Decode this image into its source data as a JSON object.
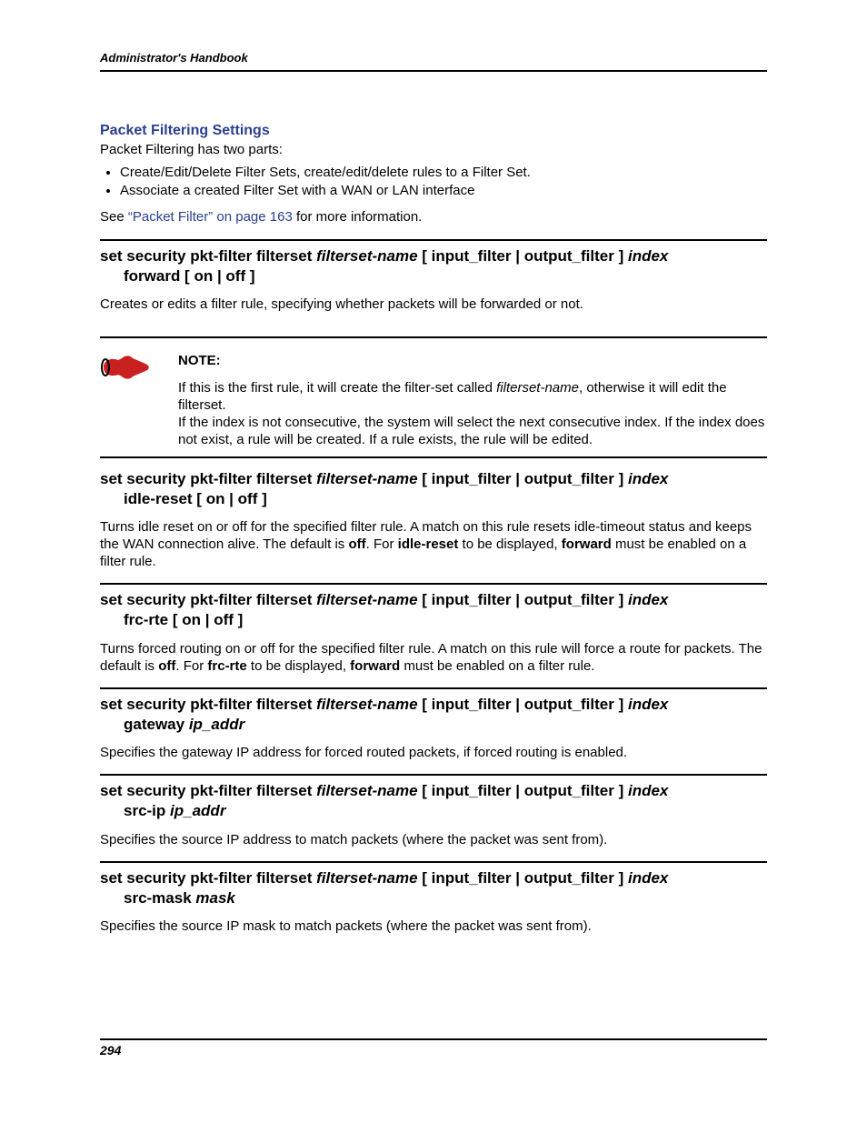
{
  "header": {
    "running": "Administrator's Handbook"
  },
  "section": {
    "title": "Packet Filtering Settings",
    "intro": "Packet Filtering has two parts:",
    "bullets": [
      "Create/Edit/Delete Filter Sets, create/edit/delete rules to a Filter Set.",
      "Associate a created Filter Set with a WAN or LAN interface"
    ],
    "see_prefix": "See ",
    "see_link": "“Packet Filter” on page 163",
    "see_suffix": " for more information."
  },
  "commands": [
    {
      "title_pre": "set security pkt-filter filterset ",
      "title_var1": "filterset-name",
      "title_mid": " [ input_filter | output_filter ] ",
      "title_var2": "index",
      "title_cont": "forward [ on | off ]",
      "desc_html": "Creates or edits a filter rule, specifying whether packets will be forwarded or not."
    },
    {
      "title_pre": "set security pkt-filter filterset ",
      "title_var1": "filterset-name",
      "title_mid": " [ input_filter | output_filter ] ",
      "title_var2": "index",
      "title_cont": "idle-reset [ on | off ]",
      "desc_html": "Turns idle reset on or off for the specified filter rule. A match on this rule resets idle-timeout status and keeps the WAN connection alive. The default is <b>off</b>. For <b>idle-reset</b> to be displayed, <b>forward</b> must be enabled on a filter rule."
    },
    {
      "title_pre": "set security pkt-filter filterset ",
      "title_var1": "filterset-name",
      "title_mid": " [ input_filter | output_filter ] ",
      "title_var2": "index",
      "title_cont": "frc-rte [ on | off ]",
      "desc_html": "Turns forced routing on or off for the specified filter rule. A match on this rule will force a route for packets. The default is <b>off</b>. For <b>frc-rte</b> to be displayed, <b>forward</b> must be enabled on a filter rule."
    },
    {
      "title_pre": "set security pkt-filter filterset ",
      "title_var1": "filterset-name",
      "title_mid": " [ input_filter | output_filter ] ",
      "title_var2": "index",
      "title_cont_pre": "gateway ",
      "title_cont_var": "ip_addr",
      "desc_html": "Specifies the gateway IP address for forced routed packets, if forced routing is enabled."
    },
    {
      "title_pre": "set security pkt-filter filterset ",
      "title_var1": "filterset-name",
      "title_mid": " [ input_filter | output_filter ] ",
      "title_var2": "index",
      "title_cont_pre": "src-ip ",
      "title_cont_var": "ip_addr",
      "desc_html": "Specifies the source IP address to match packets (where the packet was sent from)."
    },
    {
      "title_pre": "set security pkt-filter filterset ",
      "title_var1": "filterset-name",
      "title_mid": " [ input_filter | output_filter ] ",
      "title_var2": "index",
      "title_cont_pre": "src-mask ",
      "title_cont_var": "mask",
      "desc_html": "Specifies the source IP mask to match packets (where the packet was sent from)."
    }
  ],
  "note": {
    "label": "NOTE:",
    "body_html": "If this is the first rule, it will create the filter-set called <i>filterset-name</i>, otherwise it will edit the filterset.<br>If the index is not consecutive, the system will select the next consecutive index. If the index does not exist, a rule will be created. If a rule exists, the rule will be edited."
  },
  "footer": {
    "page": "294"
  }
}
